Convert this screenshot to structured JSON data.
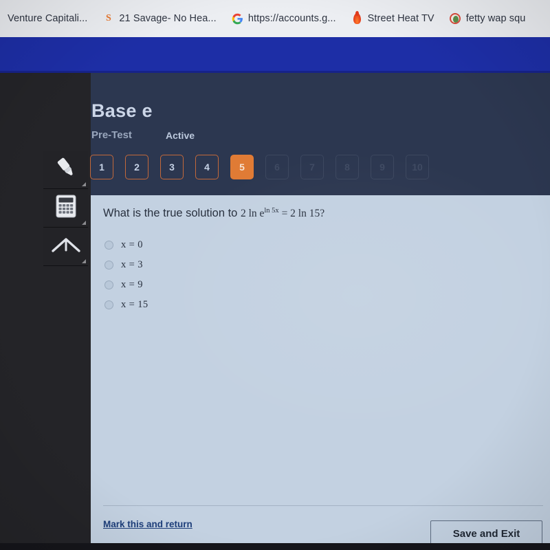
{
  "browser": {
    "bookmarks": [
      {
        "label": "Venture Capitali...",
        "icon": "none"
      },
      {
        "label": "21 Savage- No Hea...",
        "icon": "soundcloud-icon"
      },
      {
        "label": "https://accounts.g...",
        "icon": "google-icon"
      },
      {
        "label": "Street Heat TV",
        "icon": "flame-icon"
      },
      {
        "label": "fetty wap squ",
        "icon": "circle-avatar-icon"
      }
    ]
  },
  "quiz": {
    "title": "Base e",
    "subtitle": "Pre-Test",
    "status": "Active",
    "pager": [
      {
        "number": "1",
        "state": "answered"
      },
      {
        "number": "2",
        "state": "answered"
      },
      {
        "number": "3",
        "state": "answered"
      },
      {
        "number": "4",
        "state": "answered"
      },
      {
        "number": "5",
        "state": "current"
      },
      {
        "number": "6",
        "state": "locked"
      },
      {
        "number": "7",
        "state": "locked"
      },
      {
        "number": "8",
        "state": "locked"
      },
      {
        "number": "9",
        "state": "locked"
      },
      {
        "number": "10",
        "state": "locked"
      }
    ],
    "question": {
      "prompt": "What is the true solution to",
      "expression_lead": "2 ln e",
      "expression_exponent": "ln 5x",
      "expression_tail": "= 2 ln 15?"
    },
    "choices": [
      {
        "label": "x = 0",
        "selected": false
      },
      {
        "label": "x = 3",
        "selected": false
      },
      {
        "label": "x = 9",
        "selected": false
      },
      {
        "label": "x = 15",
        "selected": false
      }
    ],
    "footer": {
      "mark_link": "Mark this and return",
      "save_button": "Save and Exit"
    }
  },
  "tools": [
    {
      "name": "highlighter-tool"
    },
    {
      "name": "calculator-tool"
    },
    {
      "name": "chevron-up-tool"
    }
  ],
  "colors": {
    "accent_orange": "#e07b35",
    "browser_blue": "#1d2ea6",
    "header_navy": "#2c3750",
    "panel_bg": "#c3d1e1",
    "link_blue": "#1d3e7a"
  }
}
